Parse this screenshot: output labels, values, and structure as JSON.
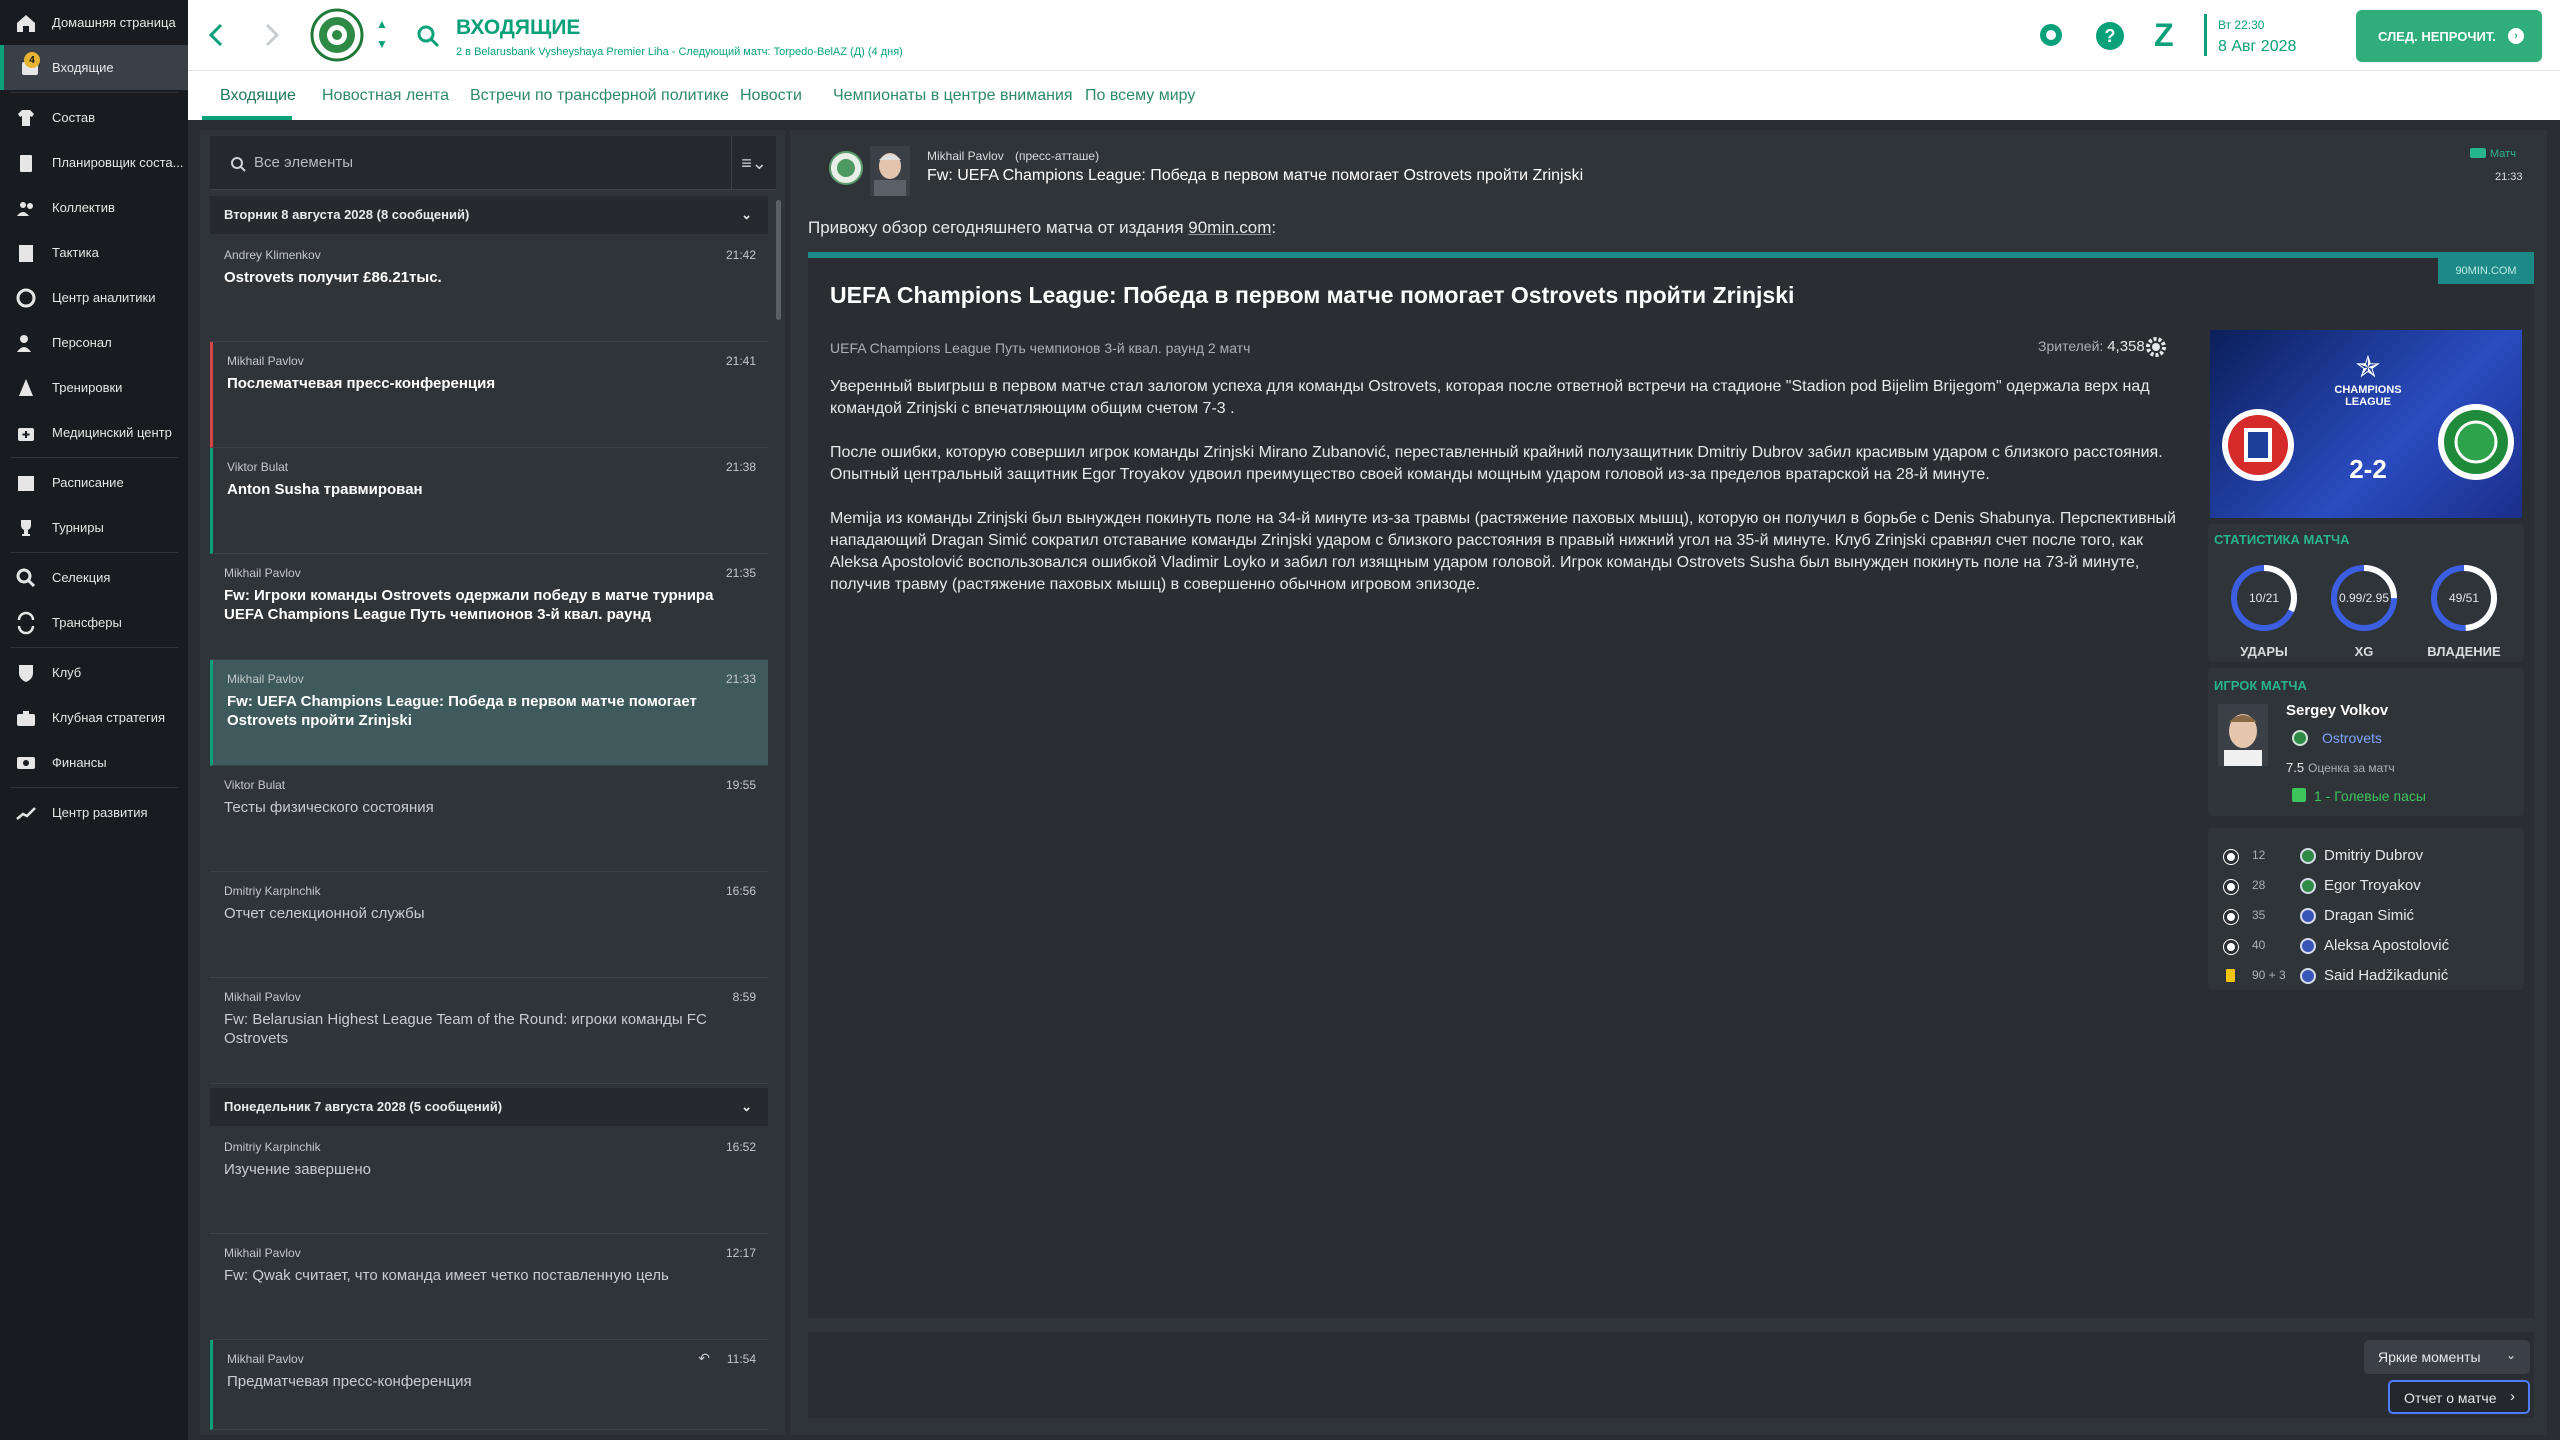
{
  "sidebar": [
    {
      "label": "Домашняя страница",
      "icon": "home-icon"
    },
    {
      "label": "Входящие",
      "icon": "inbox-icon",
      "badge": "4",
      "active": true
    },
    {
      "label": "Состав",
      "icon": "squad-shirt-icon"
    },
    {
      "label": "Планировщик соста...",
      "icon": "clipboard-icon"
    },
    {
      "label": "Коллектив",
      "icon": "people-icon"
    },
    {
      "label": "Тактика",
      "icon": "tactics-board-icon"
    },
    {
      "label": "Центр аналитики",
      "icon": "analytics-icon"
    },
    {
      "label": "Персонал",
      "icon": "staff-icon"
    },
    {
      "label": "Тренировки",
      "icon": "training-cone-icon"
    },
    {
      "label": "Медицинский центр",
      "icon": "medical-kit-icon"
    },
    {
      "label": "Расписание",
      "icon": "calendar-icon"
    },
    {
      "label": "Турниры",
      "icon": "trophy-icon"
    },
    {
      "label": "Селекция",
      "icon": "scouting-magnifier-icon"
    },
    {
      "label": "Трансферы",
      "icon": "transfer-arrows-icon"
    },
    {
      "label": "Клуб",
      "icon": "club-shield-icon"
    },
    {
      "label": "Клубная стратегия",
      "icon": "briefcase-icon"
    },
    {
      "label": "Финансы",
      "icon": "money-icon"
    },
    {
      "label": "Центр развития",
      "icon": "development-chart-icon"
    }
  ],
  "topbar": {
    "title": "ВХОДЯЩИЕ",
    "subtitle": "2 в Belarusbank Vysheyshaya Premier Liha - Следующий матч: Torpedo-BelAZ (Д) (4 дня)",
    "weekday_time": "Вт 22:30",
    "date": "8 Авг 2028",
    "continue_label": "СЛЕД. НЕПРОЧИТ.",
    "accent": "#0aa17a"
  },
  "tabs": [
    "Входящие",
    "Новостная лента",
    "Встречи по трансферной политике",
    "Новости",
    "Чемпионаты в центре внимания",
    "По всему миру"
  ],
  "inbox": {
    "search_placeholder": "Все элементы",
    "groups": [
      {
        "label": "Вторник 8 августа 2028 (8 сообщений)"
      },
      {
        "label": "Понедельник 7 августа 2028 (5 сообщений)"
      }
    ],
    "messages": [
      {
        "from": "Andrey Klimenkov",
        "time": "21:42",
        "subject": "Ostrovets получит £86.21тыс.",
        "unread": true
      },
      {
        "from": "Mikhail Pavlov",
        "time": "21:41",
        "subject": "Послематчевая пресс-конференция",
        "unread": true,
        "flag": "red"
      },
      {
        "from": "Viktor Bulat",
        "time": "21:38",
        "subject": "Anton Susha травмирован",
        "unread": true,
        "flag": "teal"
      },
      {
        "from": "Mikhail Pavlov",
        "time": "21:35",
        "subject": "Fw: Игроки команды Ostrovets одержали победу в матче турнира UEFA Champions League Путь чемпионов 3-й квал. раунд",
        "unread": true
      },
      {
        "from": "Mikhail Pavlov",
        "time": "21:33",
        "subject": "Fw: UEFA Champions League: Победа в первом матче помогает Ostrovets пройти Zrinjski",
        "unread": true,
        "selected": true
      },
      {
        "from": "Viktor Bulat",
        "time": "19:55",
        "subject": "Тесты физического состояния",
        "unread": false
      },
      {
        "from": "Dmitriy Karpinchik",
        "time": "16:56",
        "subject": "Отчет селекционной службы",
        "unread": false
      },
      {
        "from": "Mikhail Pavlov",
        "time": "8:59",
        "subject": "Fw: Belarusian Highest League Team of the Round: игроки команды FC Ostrovets",
        "unread": false
      },
      {
        "from": "Dmitriy Karpinchik",
        "time": "16:52",
        "subject": "Изучение завершено",
        "unread": false
      },
      {
        "from": "Mikhail Pavlov",
        "time": "12:17",
        "subject": "Fw: Qwak считает, что команда имеет четко поставленную цель",
        "unread": false
      },
      {
        "from": "Mikhail Pavlov",
        "time": "11:54",
        "subject": "Предматчевая пресс-конференция",
        "unread": false,
        "flag": "teal",
        "replied": true
      }
    ]
  },
  "detail": {
    "sender": "Mikhail Pavlov",
    "sender_role": "(пресс-атташе)",
    "subject": "Fw: UEFA Champions League: Победа в первом матче помогает Ostrovets пройти Zrinjski",
    "tag": "Матч",
    "time": "21:33",
    "intro_prefix": "Привожу обзор сегодняшнего матча от издания ",
    "intro_source": "90min.com",
    "intro_suffix": ":",
    "source_badge": "90MIN.COM",
    "article_title": "UEFA Champions League: Победа в первом матче помогает Ostrovets пройти Zrinjski",
    "competition": "UEFA Champions League Путь чемпионов 3-й квал. раунд 2 матч",
    "attendance_label": "Зрителей:",
    "attendance": "4,358",
    "paragraphs": [
      "Уверенный выигрыш в первом матче стал залогом успеха для команды Ostrovets, которая после ответной встречи на стадионе \"Stadion pod Bijelim Brijegom\" одержала верх над командой Zrinjski с впечатляющим общим счетом 7-3 .",
      "После ошибки, которую совершил игрок команды Zrinjski Mirano Zubanović, переставленный крайний полузащитник Dmitriy Dubrov забил красивым ударом с близкого расстояния. Опытный центральный защитник Egor Troyakov удвоил преимущество своей команды мощным ударом головой из-за пределов вратарской на 28-й минуте.",
      "Memija из команды Zrinjski был вынужден покинуть поле на 34-й минуте из-за травмы (растяжение паховых мышц), которую он получил в борьбе с Denis Shabunya. Перспективный нападающий Dragan Simić сократил отставание команды Zrinjski ударом с близкого расстояния в правый нижний угол на 35-й минуте. Клуб Zrinjski сравнял счет после того, как Aleksa Apostolović воспользовался ошибкой Vladimir Loyko и забил гол изящным ударом головой. Игрок команды Ostrovets Susha был вынужден покинуть поле на 73-й минуте, получив травму (растяжение паховых мышц) в совершенно обычном игровом эпизоде."
    ],
    "match": {
      "score": "2-2",
      "competition_logo_text": "CHAMPIONS LEAGUE",
      "home_colors": [
        "#e03131",
        "#1d3f9a"
      ],
      "away_colors": [
        "#1f8a3a",
        "#ffffff"
      ]
    },
    "stats": {
      "label": "СТАТИСТИКА МАТЧА",
      "items": [
        {
          "value": "10/21",
          "label": "УДАРЫ",
          "ratio": 0.32
        },
        {
          "value": "0.99/2.95",
          "label": "XG",
          "ratio": 0.25
        },
        {
          "value": "49/51",
          "label": "ВЛАДЕНИЕ",
          "ratio": 0.49
        }
      ]
    },
    "player_of_match": {
      "label": "ИГРОК МАТЧА",
      "name": "Sergey Volkov",
      "club": "Ostrovets",
      "rating": "7.5",
      "rating_label": "Оценка за матч",
      "assists": "1 - Голевые пасы"
    },
    "scorers": [
      {
        "minute": "12",
        "name": "Dmitriy Dubrov",
        "type": "goal",
        "team": "away"
      },
      {
        "minute": "28",
        "name": "Egor Troyakov",
        "type": "goal",
        "team": "away"
      },
      {
        "minute": "35",
        "name": "Dragan Simić",
        "type": "goal",
        "team": "home"
      },
      {
        "minute": "40",
        "name": "Aleksa Apostolović",
        "type": "goal",
        "team": "home"
      },
      {
        "minute": "90 + 3",
        "name": "Said Hadžikadunić",
        "type": "yellow",
        "team": "home"
      }
    ],
    "highlights_label": "Яркие моменты",
    "report_label": "Отчет о матче"
  }
}
